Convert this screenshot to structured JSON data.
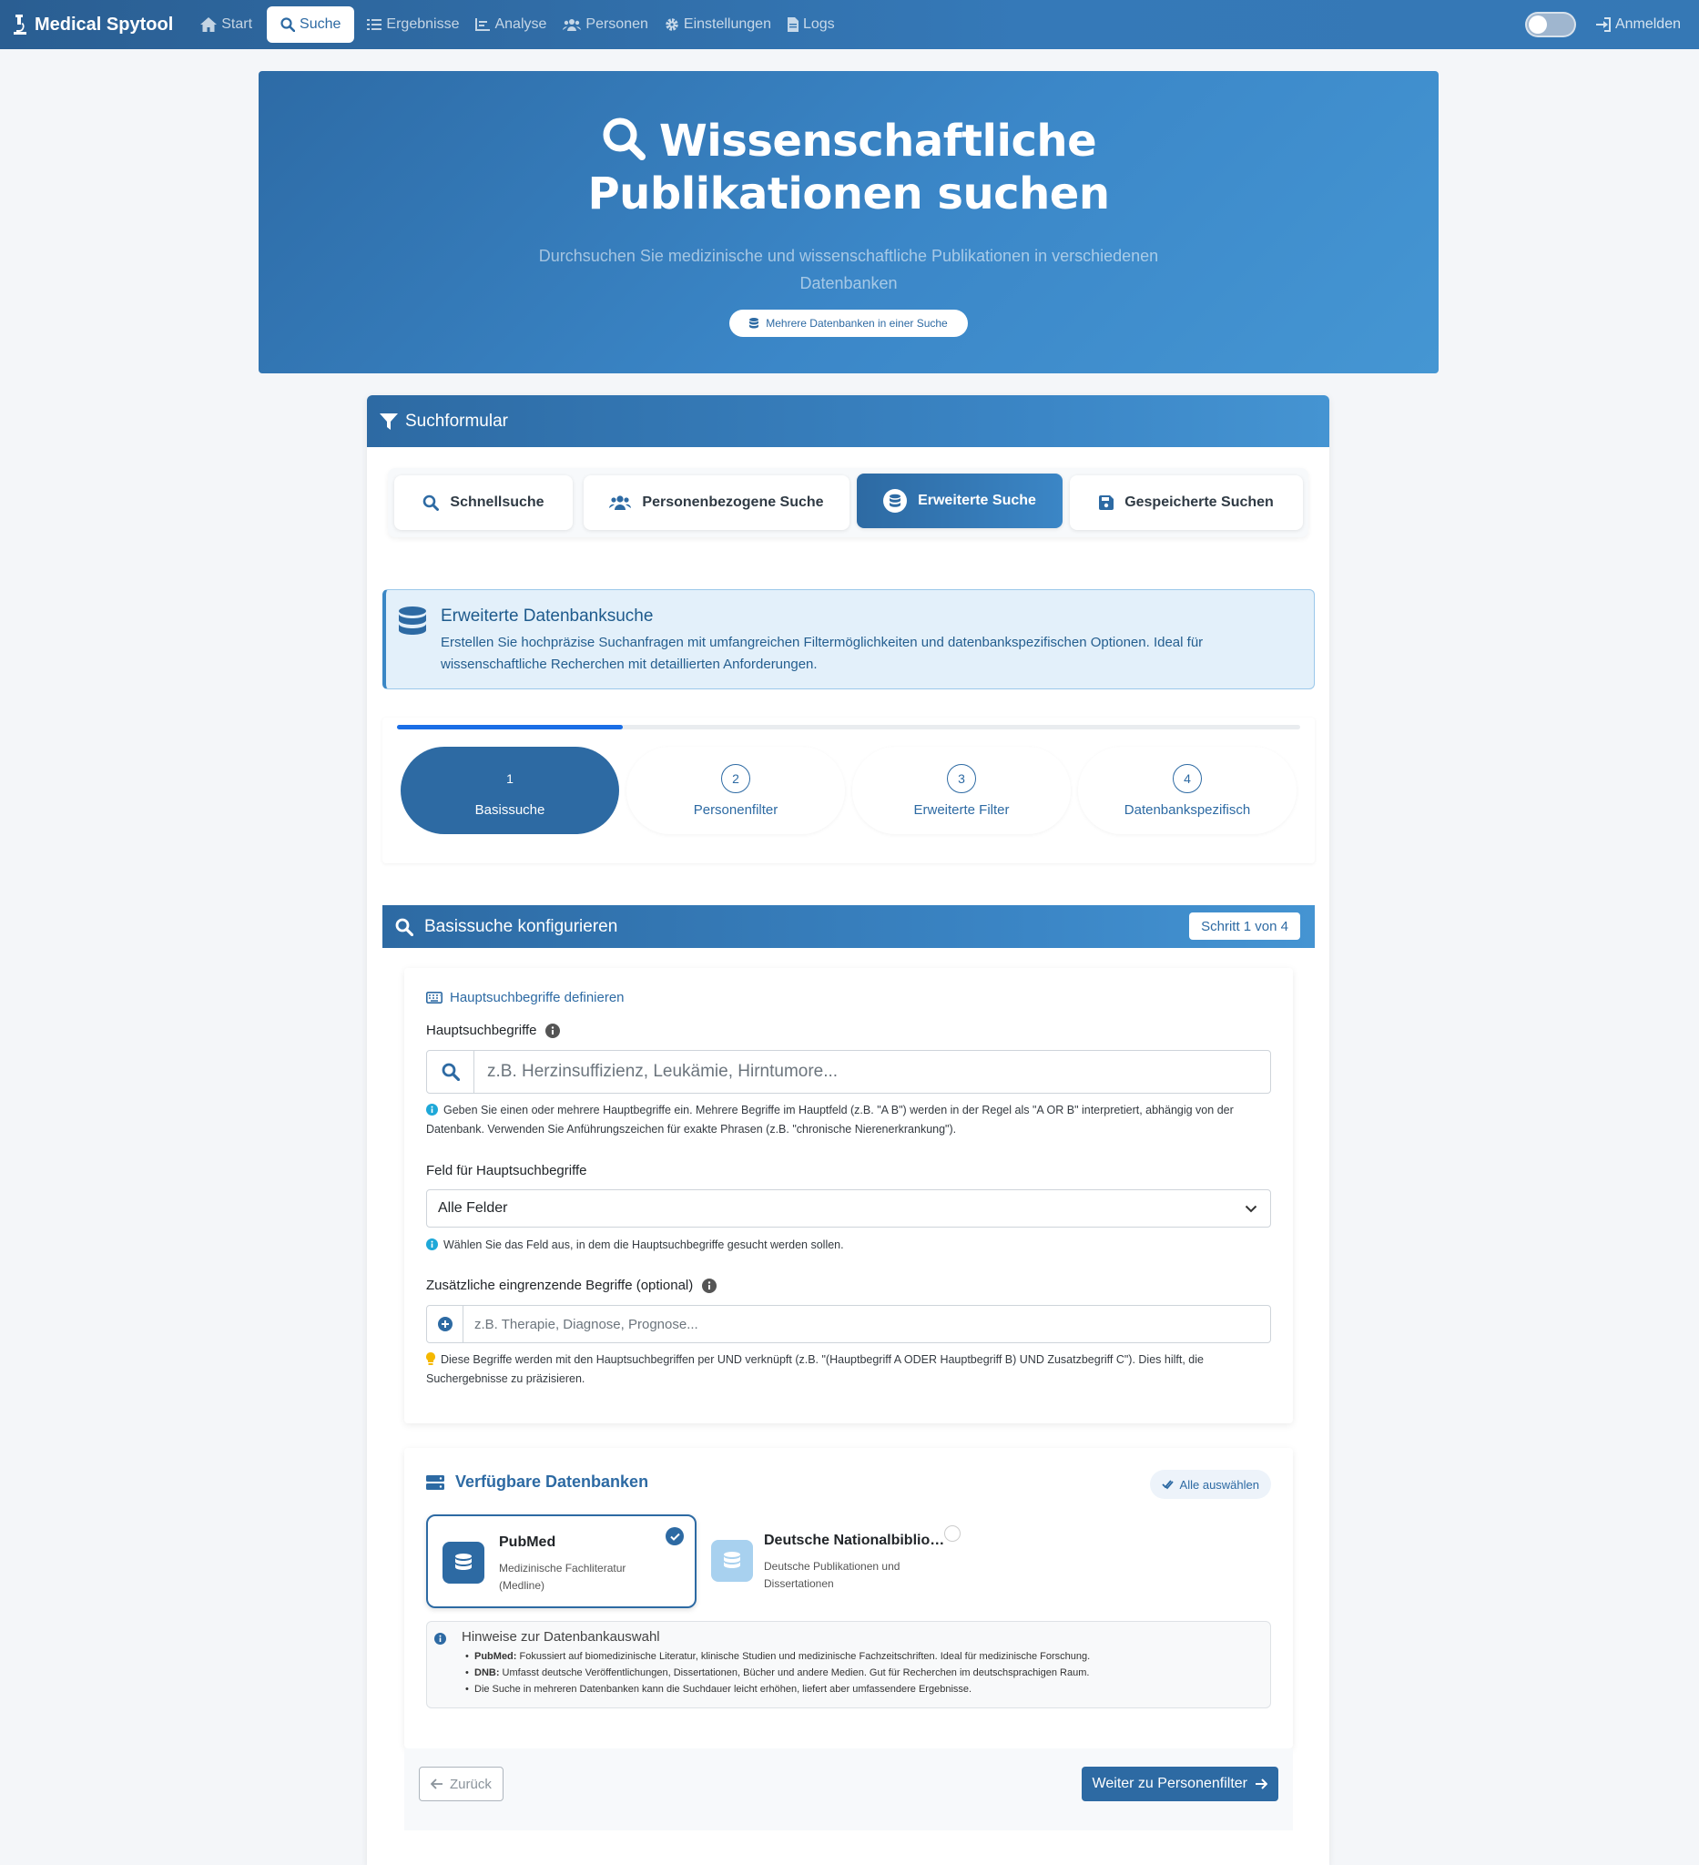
{
  "navbar": {
    "brand": "Medical Spytool",
    "items": [
      {
        "label": "Start",
        "icon": "home-icon"
      },
      {
        "label": "Suche",
        "icon": "search-icon",
        "active": true
      },
      {
        "label": "Ergebnisse",
        "icon": "list-icon"
      },
      {
        "label": "Analyse",
        "icon": "chart-icon"
      },
      {
        "label": "Personen",
        "icon": "users-icon"
      },
      {
        "label": "Einstellungen",
        "icon": "gear-icon"
      },
      {
        "label": "Logs",
        "icon": "file-icon"
      }
    ],
    "login": "Anmelden"
  },
  "hero": {
    "title": "Wissenschaftliche Publikationen suchen",
    "subtitle": "Durchsuchen Sie medizinische und wissenschaftliche Publikationen in verschiedenen Datenbanken",
    "badge": "Mehrere Datenbanken in einer Suche"
  },
  "form": {
    "header": "Suchformular",
    "tabs": [
      {
        "label": "Schnellsuche"
      },
      {
        "label": "Personenbezogene Suche"
      },
      {
        "label": "Erweiterte Suche",
        "active": true
      },
      {
        "label": "Gespeicherte Suchen"
      }
    ],
    "info": {
      "title": "Erweiterte Datenbanksuche",
      "text": "Erstellen Sie hochpräzise Suchanfragen mit umfangreichen Filtermöglichkeiten und datenbankspezifischen Optionen. Ideal für wissenschaftliche Recherchen mit detaillierten Anforderungen."
    },
    "progress_percent": 25,
    "steps": [
      {
        "num": "1",
        "label": "Basissuche",
        "active": true
      },
      {
        "num": "2",
        "label": "Personenfilter"
      },
      {
        "num": "3",
        "label": "Erweiterte Filter"
      },
      {
        "num": "4",
        "label": "Datenbankspezifisch"
      }
    ]
  },
  "basis": {
    "header": "Basissuche konfigurieren",
    "step_badge": "Schritt 1 von 4",
    "panel_title": "Hauptsuchbegriffe definieren",
    "main_label": "Hauptsuchbegriffe",
    "main_placeholder": "z.B. Herzinsuffizienz, Leukämie, Hirntumore...",
    "main_hint": "Geben Sie einen oder mehrere Hauptbegriffe ein. Mehrere Begriffe im Hauptfeld (z.B. \"A B\") werden in der Regel als \"A OR B\" interpretiert, abhängig von der Datenbank. Verwenden Sie Anführungszeichen für exakte Phrasen (z.B. \"chronische Nierenerkrankung\").",
    "field_label": "Feld für Hauptsuchbegriffe",
    "field_value": "Alle Felder",
    "field_hint": "Wählen Sie das Feld aus, in dem die Hauptsuchbegriffe gesucht werden sollen.",
    "extra_label": "Zusätzliche eingrenzende Begriffe (optional)",
    "extra_placeholder": "z.B. Therapie, Diagnose, Prognose...",
    "extra_hint": "Diese Begriffe werden mit den Hauptsuchbegriffen per UND verknüpft (z.B. \"(Hauptbegriff A ODER Hauptbegriff B) UND Zusatzbegriff C\"). Dies hilft, die Suchergebnisse zu präzisieren."
  },
  "databases": {
    "title": "Verfügbare Datenbanken",
    "select_all": "Alle auswählen",
    "items": [
      {
        "name": "PubMed",
        "desc": "Medizinische Fachliteratur (Medline)",
        "selected": true
      },
      {
        "name": "Deutsche Nationalbibliothek",
        "desc": "Deutsche Publikationen und Dissertationen",
        "selected": false
      }
    ],
    "notes_title": "Hinweise zur Datenbankauswahl",
    "notes": [
      {
        "bold": "PubMed:",
        "text": " Fokussiert auf biomedizinische Literatur, klinische Studien und medizinische Fachzeitschriften. Ideal für medizinische Forschung."
      },
      {
        "bold": "DNB:",
        "text": " Umfasst deutsche Veröffentlichungen, Dissertationen, Bücher und andere Medien. Gut für Recherchen im deutschsprachigen Raum."
      },
      {
        "bold": "",
        "text": "Die Suche in mehreren Datenbanken kann die Suchdauer leicht erhöhen, liefert aber umfassendere Ergebnisse."
      }
    ]
  },
  "buttons": {
    "back": "Zurück",
    "next": "Weiter zu Personenfilter"
  },
  "colors": {
    "primary": "#2d6aa3",
    "accent": "#3b86c6",
    "progress": "#1a6ee6"
  }
}
